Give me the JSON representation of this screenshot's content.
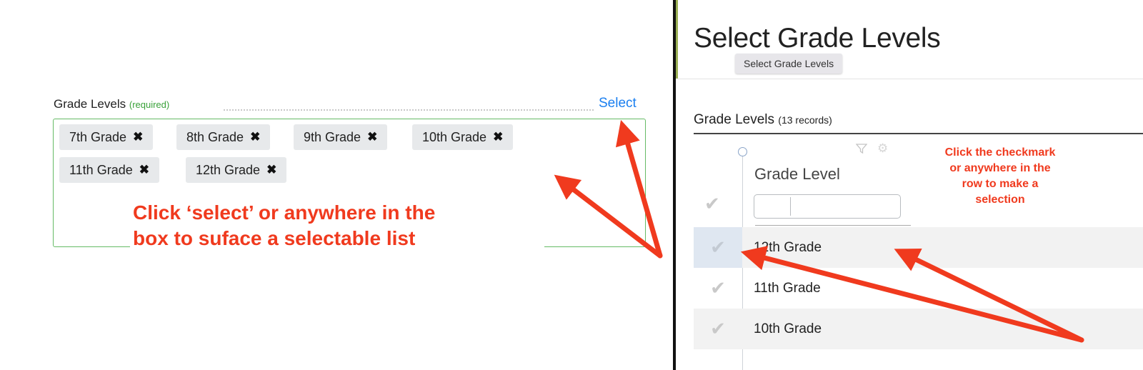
{
  "left_panel": {
    "field_label": "Grade Levels",
    "required_text": "(required)",
    "select_link": "Select",
    "chips": [
      {
        "label": "7th Grade",
        "remove_icon": "close-icon"
      },
      {
        "label": "8th Grade",
        "remove_icon": "close-icon"
      },
      {
        "label": "9th Grade",
        "remove_icon": "close-icon"
      },
      {
        "label": "10th Grade",
        "remove_icon": "close-icon"
      },
      {
        "label": "11th Grade",
        "remove_icon": "close-icon"
      },
      {
        "label": "12th Grade",
        "remove_icon": "close-icon"
      }
    ],
    "chip_remove_glyph": "✖",
    "annotation": [
      "Click ‘select’ or anywhere in the",
      "box to suface a selectable list"
    ]
  },
  "right_panel": {
    "modal_title": "Select Grade Levels",
    "tooltip": "Select Grade Levels",
    "section_title": "Grade Levels",
    "section_count": "(13 records)",
    "column_header": "Grade Level",
    "icons": {
      "filter": "filter-icon",
      "settings": "gear-icon",
      "check": "checkmark-icon"
    },
    "check_glyph": "✔",
    "rows": [
      {
        "label": "12th Grade",
        "highlighted": true
      },
      {
        "label": "11th Grade",
        "highlighted": false
      },
      {
        "label": "10th Grade",
        "highlighted": false
      }
    ],
    "annotation": [
      "Click the checkmark",
      "or anywhere in the",
      "row to make a",
      "selection"
    ]
  },
  "colors": {
    "annotation_red": "#f03a1e",
    "link_blue": "#1a7ff0",
    "required_green": "#3aa23a",
    "box_border_green": "#66bb66",
    "chip_bg": "#e7e9eb",
    "row_alt_bg": "#f2f2f2",
    "active_check_bg": "#dfe7f1"
  }
}
